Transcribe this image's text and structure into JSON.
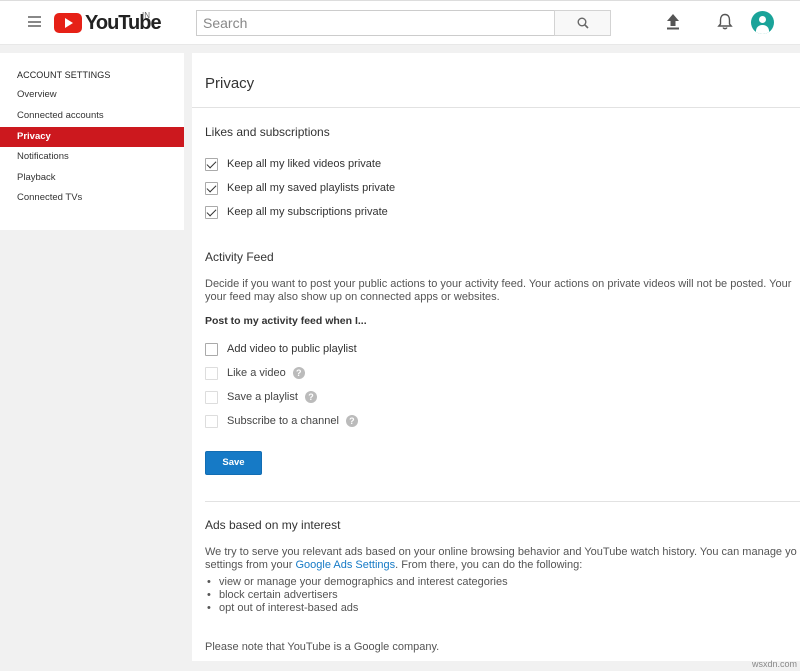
{
  "header": {
    "logo_text": "YouTube",
    "region": "IN",
    "search_placeholder": "Search"
  },
  "sidebar": {
    "heading": "ACCOUNT SETTINGS",
    "items": [
      {
        "label": "Overview"
      },
      {
        "label": "Connected accounts"
      },
      {
        "label": "Privacy",
        "active": true
      },
      {
        "label": "Notifications"
      },
      {
        "label": "Playback"
      },
      {
        "label": "Connected TVs"
      }
    ]
  },
  "main": {
    "title": "Privacy",
    "likes": {
      "heading": "Likes and subscriptions",
      "options": [
        {
          "label": "Keep all my liked videos private",
          "checked": true
        },
        {
          "label": "Keep all my saved playlists private",
          "checked": true
        },
        {
          "label": "Keep all my subscriptions private",
          "checked": true
        }
      ]
    },
    "activity": {
      "heading": "Activity Feed",
      "description_line1": "Decide if you want to post your public actions to your activity feed. Your actions on private videos will not be posted. Your",
      "description_line2": "your feed may also show up on connected apps or websites.",
      "subheading": "Post to my activity feed when I...",
      "options": [
        {
          "label": "Add video to public playlist",
          "checked": false
        },
        {
          "label": "Like a video",
          "checked": false,
          "help": "?"
        },
        {
          "label": "Save a playlist",
          "checked": false,
          "help": "?"
        },
        {
          "label": "Subscribe to a channel",
          "checked": false,
          "help": "?"
        }
      ],
      "save_label": "Save"
    },
    "ads": {
      "heading": "Ads based on my interest",
      "line1": "We try to serve you relevant ads based on your online browsing behavior and YouTube watch history. You can manage yo",
      "line2_prefix": "settings from your ",
      "line2_link": "Google Ads Settings",
      "line2_suffix": ". From there, you can do the following:",
      "bullets": [
        "view or manage your demographics and interest categories",
        "block certain advertisers",
        "opt out of interest-based ads"
      ],
      "note": "Please note that YouTube is a Google company."
    }
  },
  "watermark": "wsxdn.com",
  "colors": {
    "accent_red": "#cc181e",
    "brand_red": "#e62117",
    "button_blue": "#167ac6",
    "avatar_teal": "#1aa399"
  }
}
